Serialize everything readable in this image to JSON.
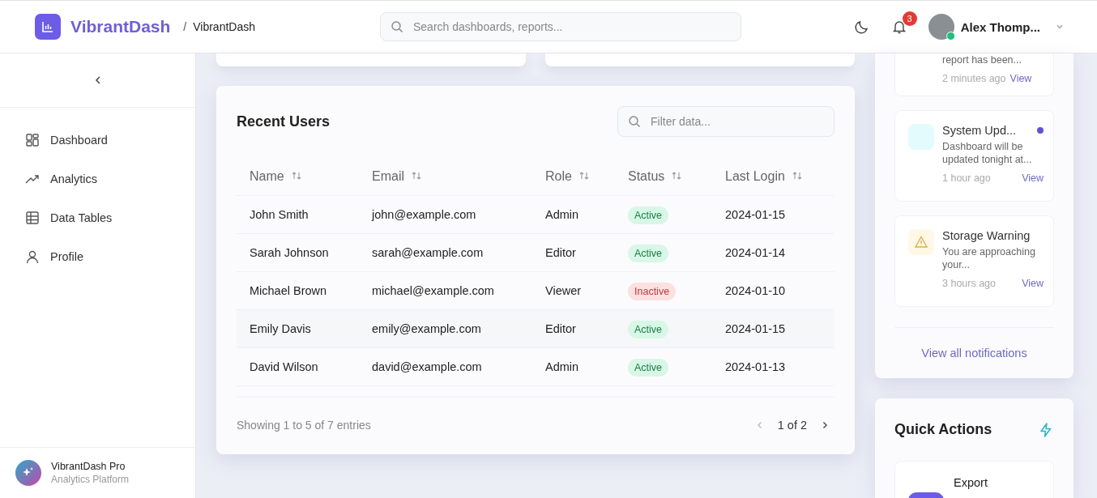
{
  "header": {
    "brand": "VibrantDash",
    "breadcrumb_separator": "/",
    "breadcrumb": "VibrantDash",
    "search": {
      "placeholder": "Search dashboards, reports..."
    },
    "notification_count": "3",
    "user": {
      "name": "Alex Thomp...",
      "online": true
    }
  },
  "sidebar": {
    "items": [
      {
        "label": "Dashboard"
      },
      {
        "label": "Analytics"
      },
      {
        "label": "Data Tables"
      },
      {
        "label": "Profile"
      }
    ],
    "footer": {
      "title": "VibrantDash Pro",
      "subtitle": "Analytics Platform"
    }
  },
  "recent_users": {
    "title": "Recent Users",
    "filter": {
      "placeholder": "Filter data..."
    },
    "columns": [
      "Name",
      "Email",
      "Role",
      "Status",
      "Last Login"
    ],
    "rows": [
      {
        "name": "John Smith",
        "email": "john@example.com",
        "role": "Admin",
        "status": "Active",
        "active": true,
        "last_login": "2024-01-15"
      },
      {
        "name": "Sarah Johnson",
        "email": "sarah@example.com",
        "role": "Editor",
        "status": "Active",
        "active": true,
        "last_login": "2024-01-14"
      },
      {
        "name": "Michael Brown",
        "email": "michael@example.com",
        "role": "Viewer",
        "status": "Inactive",
        "active": false,
        "last_login": "2024-01-10"
      },
      {
        "name": "Emily Davis",
        "email": "emily@example.com",
        "role": "Editor",
        "status": "Active",
        "active": true,
        "last_login": "2024-01-15"
      },
      {
        "name": "David Wilson",
        "email": "david@example.com",
        "role": "Admin",
        "status": "Active",
        "active": true,
        "last_login": "2024-01-13"
      }
    ],
    "summary": "Showing 1 to 5 of 7 entries",
    "page": "1 of 2"
  },
  "notifications": {
    "items": [
      {
        "kind": "none",
        "message": "report has been...",
        "time": "2 minutes ago",
        "action": "View"
      },
      {
        "kind": "info",
        "title": "System Upd...",
        "message": "Dashboard will be updated tonight at...",
        "time": "1 hour ago",
        "action": "View",
        "unread": true
      },
      {
        "kind": "warning",
        "title": "Storage Warning",
        "message": "You are approaching your...",
        "time": "3 hours ago",
        "action": "View",
        "unread": false
      }
    ],
    "view_all": "View all notifications"
  },
  "quick_actions": {
    "title": "Quick Actions",
    "items": [
      {
        "label": "Export"
      }
    ]
  }
}
